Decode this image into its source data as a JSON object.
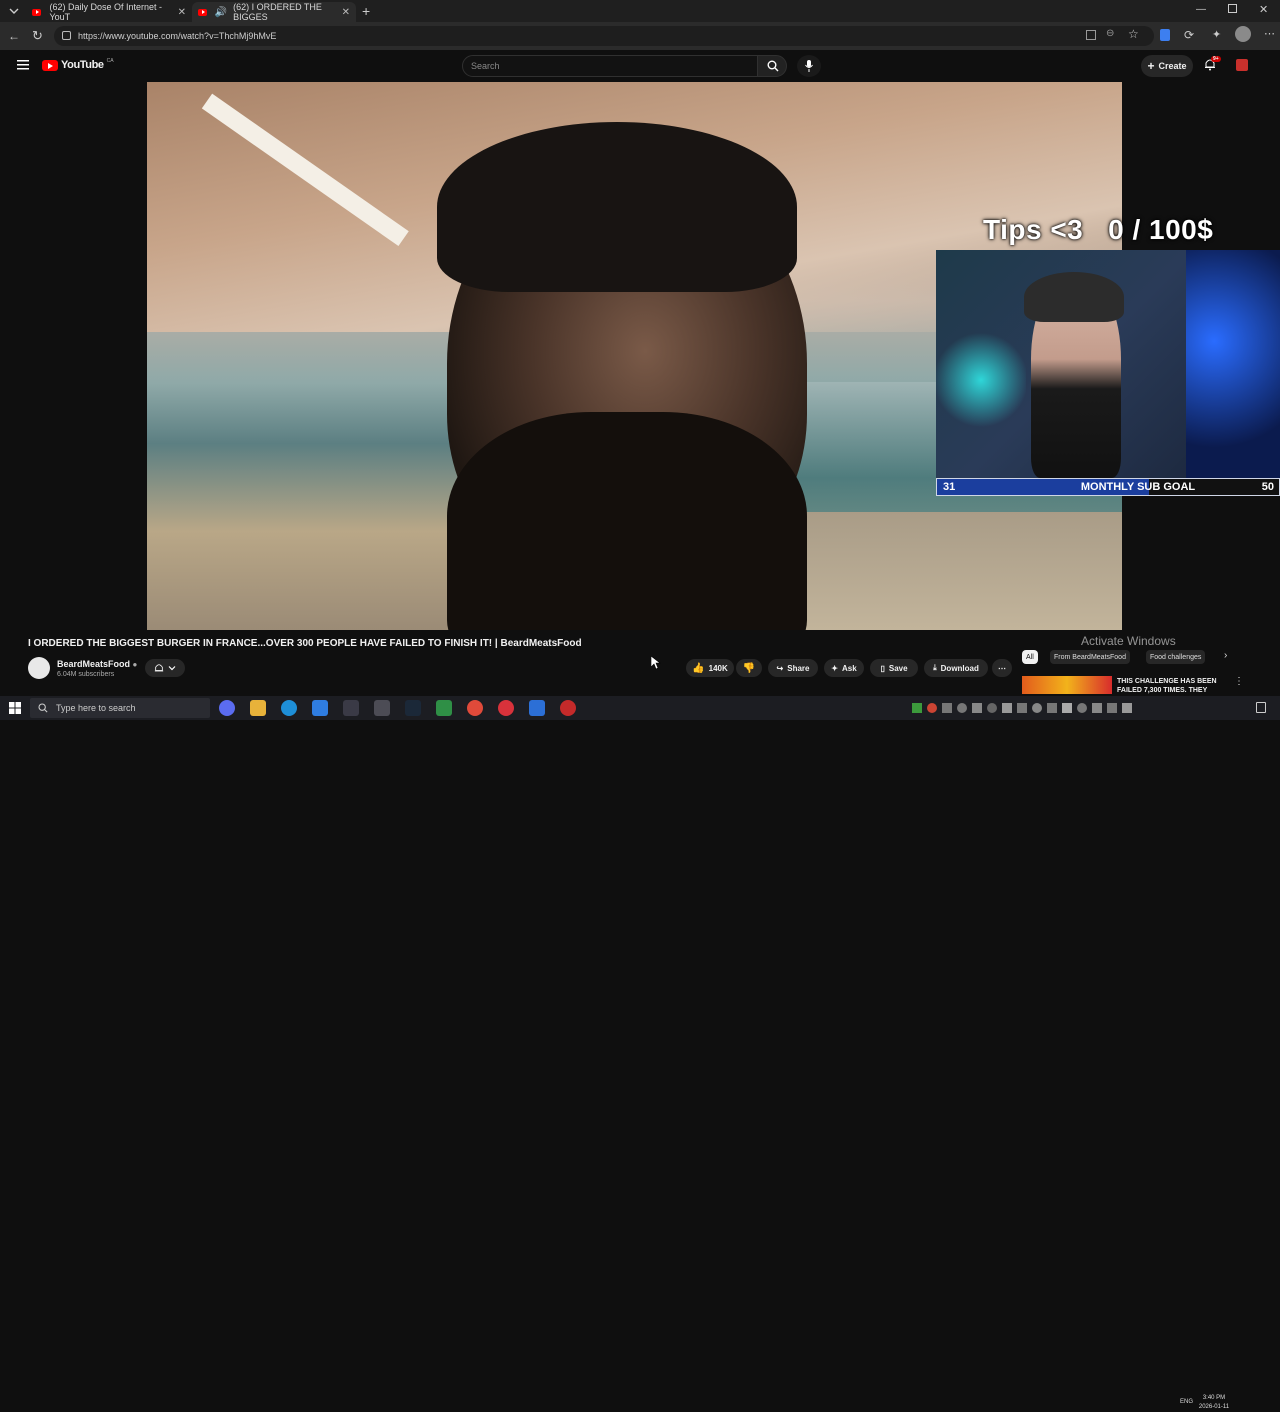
{
  "browser": {
    "tabs": [
      {
        "title": "(62) Daily Dose Of Internet - YouT",
        "active": false
      },
      {
        "title": "(62) I ORDERED THE BIGGES",
        "active": true
      }
    ],
    "url": "https://www.youtube.com/watch?v=ThchMj9hMvE"
  },
  "youtube": {
    "logo_text": "YouTube",
    "logo_region": "CA",
    "search_placeholder": "Search",
    "create_label": "Create",
    "notification_badge": "9+"
  },
  "overlay": {
    "tips_text": "Tips <3   0 / 100$",
    "subgoal_current": "31",
    "subgoal_label": "MONTHLY SUB GOAL",
    "subgoal_max": "50",
    "subgoal_progress": 0.62
  },
  "video": {
    "title": "I ORDERED THE BIGGEST BURGER IN FRANCE...OVER 300 PEOPLE HAVE FAILED TO FINISH IT! | BeardMeatsFood",
    "channel": "BeardMeatsFood",
    "subscribers": "6.04M subscribers",
    "likes": "140K",
    "share_label": "Share",
    "ask_label": "Ask",
    "save_label": "Save",
    "download_label": "Download"
  },
  "sidebar": {
    "watermark": "Activate Windows",
    "chips": [
      "All",
      "From BeardMeatsFood",
      "Food challenges"
    ],
    "related_title": "THIS CHALLENGE HAS BEEN FAILED 7,300 TIMES. THEY"
  },
  "taskbar": {
    "search_placeholder": "Type here to search",
    "language": "ENG",
    "time": "3:40 PM",
    "date": "2026-01-11"
  }
}
